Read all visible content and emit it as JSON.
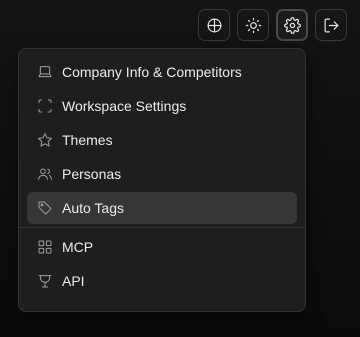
{
  "toolbar": {
    "buttons": [
      {
        "icon": "globe-icon"
      },
      {
        "icon": "sun-icon"
      },
      {
        "icon": "gear-icon",
        "active": true
      },
      {
        "icon": "logout-icon"
      }
    ]
  },
  "menu": {
    "items": [
      {
        "label": "Company Info & Competitors",
        "icon": "laptop-icon"
      },
      {
        "label": "Workspace Settings",
        "icon": "scan-frame-icon"
      },
      {
        "label": "Themes",
        "icon": "star-icon"
      },
      {
        "label": "Personas",
        "icon": "users-icon"
      },
      {
        "label": "Auto Tags",
        "icon": "tag-icon",
        "highlighted": true
      },
      {
        "label": "MCP",
        "icon": "grid-icon"
      },
      {
        "label": "API",
        "icon": "signpost-icon"
      }
    ]
  },
  "colors": {
    "background": "#0e0e0e",
    "menu_bg": "#1e1e1e",
    "highlight": "#363636",
    "icon": "#a0a0a0",
    "text": "#ececec"
  }
}
